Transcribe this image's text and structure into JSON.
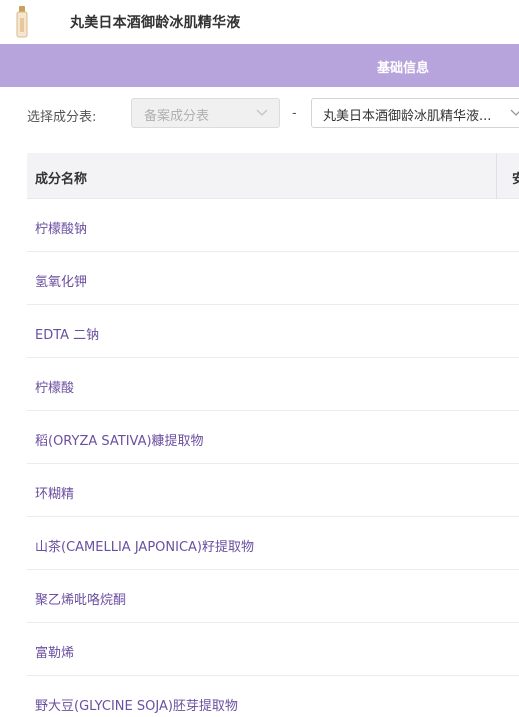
{
  "header": {
    "product_title": "丸美日本酒御龄冰肌精华液",
    "product_thumb_icon": "serum-bottle-icon"
  },
  "tabs": {
    "active_label": "基础信息"
  },
  "filter": {
    "label": "选择成分表:",
    "list_select_value": "备案成分表",
    "separator": "-",
    "product_select_value": "丸美日本酒御龄冰肌精华液..."
  },
  "table": {
    "columns": [
      "成分名称",
      "安"
    ],
    "rows": [
      "柠檬酸钠",
      "氢氧化钾",
      "EDTA 二钠",
      "柠檬酸",
      "稻(ORYZA SATIVA)糠提取物",
      "环糊精",
      "山茶(CAMELLIA JAPONICA)籽提取物",
      "聚乙烯吡咯烷酮",
      "富勒烯",
      "野大豆(GLYCINE SOJA)胚芽提取物"
    ]
  },
  "colors": {
    "accent": "#b8a4dc",
    "link": "#6b4fa0",
    "header_bg": "#f3f3f6"
  }
}
